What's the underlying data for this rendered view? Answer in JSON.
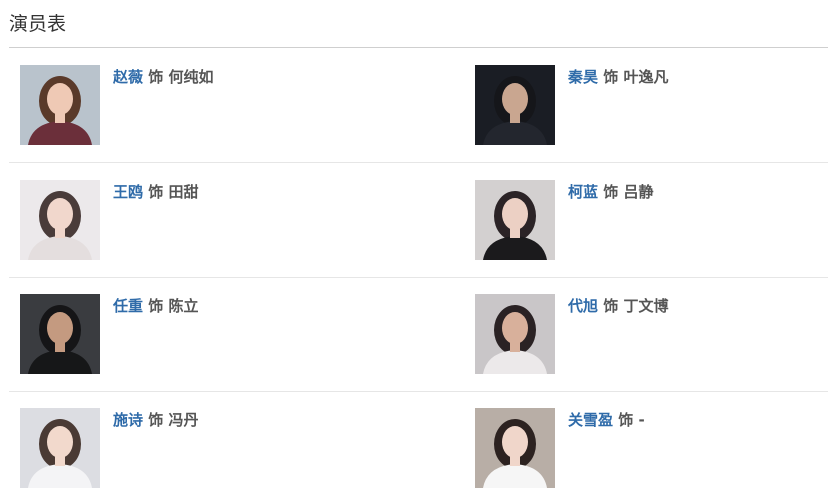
{
  "section": {
    "title": "演员表"
  },
  "cast": [
    {
      "actor": "赵薇",
      "role_prefix": "饰",
      "role": "何纯如",
      "photo_bg": "#b9c3cc",
      "hair": "#5a3a2a",
      "skin": "#efc9b5",
      "clothes": "#6b2f3a"
    },
    {
      "actor": "秦昊",
      "role_prefix": "饰",
      "role": "叶逸凡",
      "photo_bg": "#1a1d24",
      "hair": "#15161a",
      "skin": "#c9a690",
      "clothes": "#23262e"
    },
    {
      "actor": "王鸥",
      "role_prefix": "饰",
      "role": "田甜",
      "photo_bg": "#ece9eb",
      "hair": "#4a3c3a",
      "skin": "#f1d7cc",
      "clothes": "#e4dede"
    },
    {
      "actor": "柯蓝",
      "role_prefix": "饰",
      "role": "吕静",
      "photo_bg": "#d3d0d0",
      "hair": "#2b2326",
      "skin": "#ecd0c4",
      "clothes": "#1b1a1c"
    },
    {
      "actor": "任重",
      "role_prefix": "饰",
      "role": "陈立",
      "photo_bg": "#3a3c40",
      "hair": "#151517",
      "skin": "#c49a80",
      "clothes": "#161718"
    },
    {
      "actor": "代旭",
      "role_prefix": "饰",
      "role": "丁文博",
      "photo_bg": "#c9c6c8",
      "hair": "#2a2224",
      "skin": "#d8b09b",
      "clothes": "#ece9ea"
    },
    {
      "actor": "施诗",
      "role_prefix": "饰",
      "role": "冯丹",
      "photo_bg": "#dcdde2",
      "hair": "#4a3a34",
      "skin": "#f2d9cc",
      "clothes": "#f4f4f6"
    },
    {
      "actor": "关雪盈",
      "role_prefix": "饰",
      "role": "-",
      "photo_bg": "#b8aea6",
      "hair": "#2c2220",
      "skin": "#f0d6ca",
      "clothes": "#f6f6f6"
    }
  ]
}
